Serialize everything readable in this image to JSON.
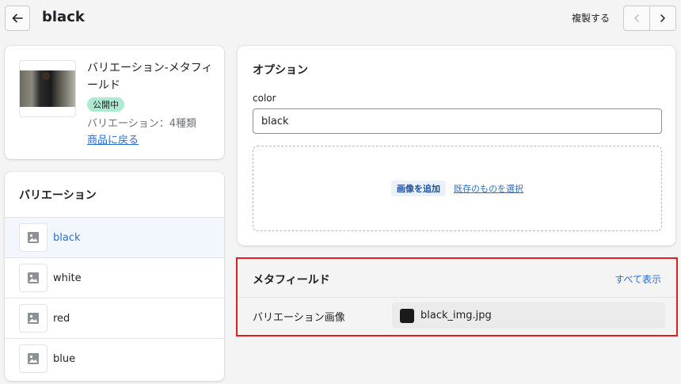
{
  "header": {
    "title": "black",
    "duplicate_label": "複製する",
    "back_icon": "arrow-left-icon",
    "prev_icon": "chevron-left-icon",
    "next_icon": "chevron-right-icon"
  },
  "product": {
    "name": "バリエーション-メタフィールド",
    "status": "公開中",
    "variant_count": "バリエーション：4種類",
    "back_link": "商品に戻る",
    "status_color": "#aee9d1"
  },
  "variations": {
    "heading": "バリエーション",
    "items": [
      {
        "label": "black",
        "active": true
      },
      {
        "label": "white",
        "active": false
      },
      {
        "label": "red",
        "active": false
      },
      {
        "label": "blue",
        "active": false
      }
    ]
  },
  "options": {
    "heading": "オプション",
    "field_label": "color",
    "field_value": "black",
    "add_image_label": "画像を追加",
    "select_existing_label": "既存のものを選択"
  },
  "metafields": {
    "heading": "メタフィールド",
    "show_all": "すべて表示",
    "row_label": "バリエーション画像",
    "row_value": "black_img.jpg",
    "highlight_color": "#e11f1f"
  }
}
